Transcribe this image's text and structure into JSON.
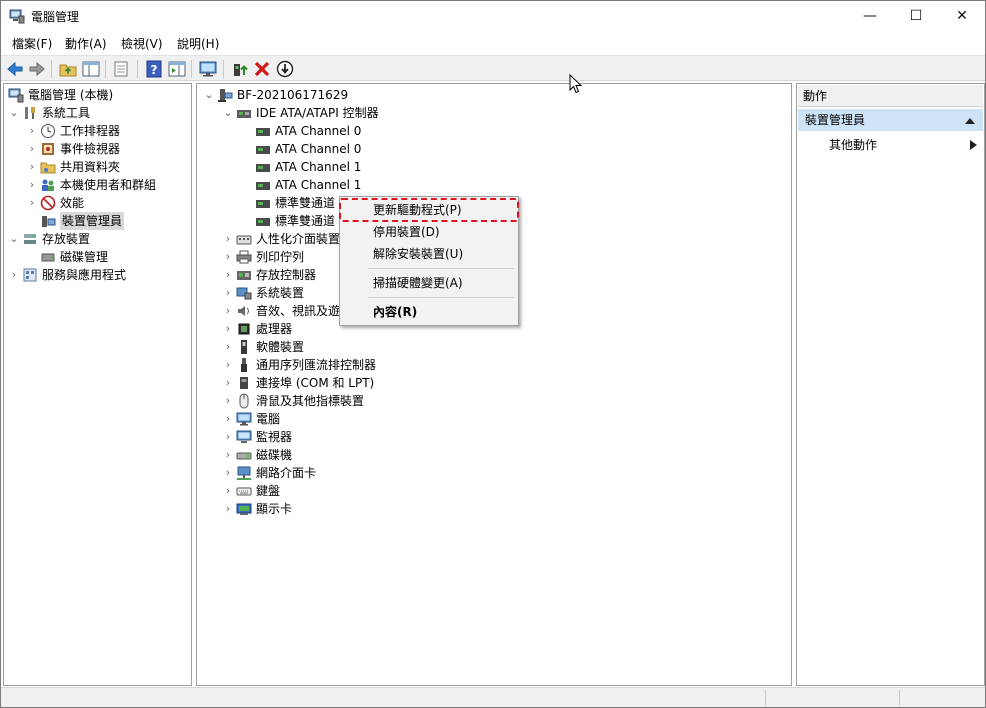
{
  "window": {
    "title": "電腦管理",
    "controls": {
      "minimize": "—",
      "maximize": "☐",
      "close": "✕"
    }
  },
  "menubar": {
    "items": [
      "檔案(F)",
      "動作(A)",
      "檢視(V)",
      "說明(H)"
    ]
  },
  "toolbar": {
    "icons": [
      "back-icon",
      "forward-icon",
      "up-folder-icon",
      "show-hide-tree-icon",
      "properties-icon",
      "help-icon",
      "show-hide-action-icon",
      "monitor-icon",
      "update-driver-icon",
      "uninstall-icon",
      "disable-icon"
    ]
  },
  "left_tree": {
    "root": "電腦管理 (本機)",
    "items": [
      {
        "label": "系統工具",
        "level": 1,
        "expanded": true,
        "icon": "tools-icon"
      },
      {
        "label": "工作排程器",
        "level": 2,
        "expanded": false,
        "icon": "clock-icon"
      },
      {
        "label": "事件檢視器",
        "level": 2,
        "expanded": false,
        "icon": "event-viewer-icon"
      },
      {
        "label": "共用資料夾",
        "level": 2,
        "expanded": false,
        "icon": "shared-folder-icon"
      },
      {
        "label": "本機使用者和群組",
        "level": 2,
        "expanded": false,
        "icon": "users-icon"
      },
      {
        "label": "效能",
        "level": 2,
        "expanded": false,
        "icon": "performance-icon"
      },
      {
        "label": "裝置管理員",
        "level": 2,
        "expanded": null,
        "icon": "device-manager-icon",
        "selected": true
      },
      {
        "label": "存放裝置",
        "level": 1,
        "expanded": true,
        "icon": "storage-icon"
      },
      {
        "label": "磁碟管理",
        "level": 2,
        "expanded": null,
        "icon": "disk-management-icon"
      },
      {
        "label": "服務與應用程式",
        "level": 1,
        "expanded": false,
        "icon": "services-icon"
      }
    ]
  },
  "device_tree": {
    "root": "BF-202106171629",
    "ide_group": "IDE ATA/ATAPI 控制器",
    "ide_children": [
      "ATA Channel 0",
      "ATA Channel 0",
      "ATA Channel 1",
      "ATA Channel 1",
      "標準雙通道",
      "標準雙通道"
    ],
    "categories": [
      {
        "label": "人性化介面裝置",
        "icon": "hid-icon"
      },
      {
        "label": "列印佇列",
        "icon": "printer-icon"
      },
      {
        "label": "存放控制器",
        "icon": "storage-controller-icon"
      },
      {
        "label": "系統裝置",
        "icon": "system-device-icon"
      },
      {
        "label": "音效、視訊及遊",
        "icon": "audio-icon"
      },
      {
        "label": "處理器",
        "icon": "processor-icon"
      },
      {
        "label": "軟體裝置",
        "icon": "software-device-icon"
      },
      {
        "label": "通用序列匯流排控制器",
        "icon": "usb-icon"
      },
      {
        "label": "連接埠 (COM 和 LPT)",
        "icon": "port-icon"
      },
      {
        "label": "滑鼠及其他指標裝置",
        "icon": "mouse-icon"
      },
      {
        "label": "電腦",
        "icon": "computer-icon"
      },
      {
        "label": "監視器",
        "icon": "monitor-icon"
      },
      {
        "label": "磁碟機",
        "icon": "disk-drive-icon"
      },
      {
        "label": "網路介面卡",
        "icon": "network-icon"
      },
      {
        "label": "鍵盤",
        "icon": "keyboard-icon"
      },
      {
        "label": "顯示卡",
        "icon": "display-adapter-icon"
      }
    ]
  },
  "context_menu": {
    "items": [
      "更新驅動程式(P)",
      "停用裝置(D)",
      "解除安裝裝置(U)",
      "掃描硬體變更(A)",
      "內容(R)"
    ],
    "highlight_color": "#e0141e"
  },
  "actions_pane": {
    "header": "動作",
    "section": "裝置管理員",
    "item": "其他動作"
  }
}
